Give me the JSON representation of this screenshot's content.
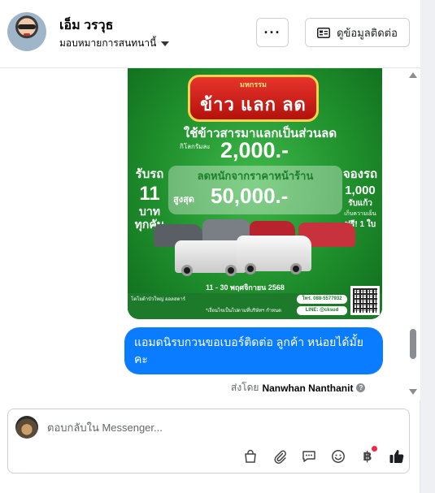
{
  "header": {
    "contact_name": "เอ็ม วรวุธ",
    "assign_label": "มอบหมายการสนทนานี้",
    "more_label": "···",
    "contact_info_label": "ดูข้อมูลติดต่อ"
  },
  "poster": {
    "badge_small": "มหกรรม",
    "badge_big": "ข้าว แลก ลด",
    "headline": "ใช้ข้าวสารมาแลกเป็นส่วนลด",
    "per_kg_label": "กิโลกรัมละ",
    "per_kg_amount": "2,000.-",
    "left_line1": "รับรถ",
    "left_line2": "11",
    "left_line3": "บาท",
    "left_line4": "ทุกคัน",
    "right_line1": "จองรถ",
    "right_line2": "1,000",
    "right_line3": "รับแก้ว",
    "right_line4": "เก็บความเย็น",
    "right_line5": "ฟรี! 1 ใบ",
    "discount_line": "ลดหนักจากราคาหน้าร้าน",
    "max_label": "สูงสุด",
    "max_amount": "50,000.-",
    "date_range": "11 - 30 พฤศจิกายน 2568",
    "footer_dealer": "โตโยต้าบัวใหญ่ ออลสตาร์",
    "footer_note": "*เงื่อนไขเป็นไปตามที่บริษัทฯ กำหนด",
    "footer_tel": "โทร. 088-5577932",
    "footer_line": "LINE: @cksud"
  },
  "message": {
    "text": "แอมดนิรบกวนขอเบอร์ติดต่อ ลูกค้า  หน่อยได้มั้ยคะ",
    "sent_by_prefix": "ส่งโดย",
    "sent_by_name": "Nanwhan Nanthanit",
    "help": "?"
  },
  "composer": {
    "placeholder": "ตอบกลับใน Messenger...",
    "icons": [
      "shopping-bag-icon",
      "paperclip-icon",
      "chat-bubble-icon",
      "smiley-icon",
      "baht-icon",
      "thumbs-up-icon"
    ],
    "baht_symbol": "฿"
  },
  "colors": {
    "bubble": "#0a7cff",
    "like": "#0a7cff",
    "poster_green": "#1f8f2c",
    "badge_red": "#e8342c",
    "notification": "#f02849"
  }
}
